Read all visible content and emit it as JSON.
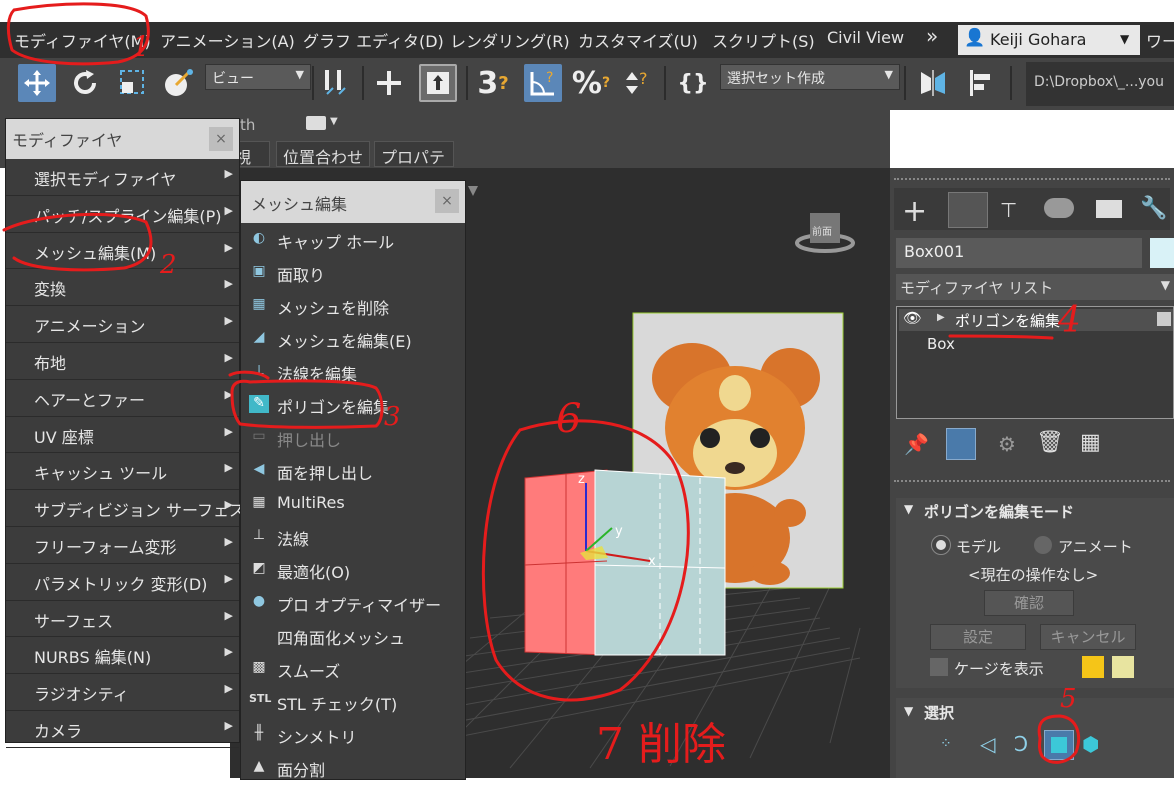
{
  "menubar": {
    "items": [
      "モディファイヤ(M)",
      "アニメーション(A)",
      "グラフ エディタ(D)",
      "レンダリング(R)",
      "カスタマイズ(U)",
      "スクリプト(S)",
      "Civil View"
    ],
    "more": "»",
    "user": "Keiji Gohara",
    "workspace": "ワー"
  },
  "toolbar": {
    "view_dropdown": "ビュー",
    "selection_set": "選択セット作成",
    "path": "D:\\Dropbox\\_...you"
  },
  "row3": {
    "tab_partial": "th",
    "tabs": [
      "視性",
      "位置合わせ",
      "プロパティ"
    ]
  },
  "modifier_menu": {
    "title": "モディファイヤ",
    "close": "×",
    "items": [
      "選択モディファイヤ",
      "パッチ/スプライン編集(P)",
      "メッシュ編集(M)",
      "変換",
      "アニメーション",
      "布地",
      "ヘアーとファー",
      "UV 座標",
      "キャッシュ ツール",
      "サブディビジョン サーフェス",
      "フリーフォーム変形",
      "パラメトリック 変形(D)",
      "サーフェス",
      "NURBS 編集(N)",
      "ラジオシティ",
      "カメラ"
    ]
  },
  "mesh_menu": {
    "title": "メッシュ編集",
    "close": "×",
    "items": [
      "キャップ ホール",
      "面取り",
      "メッシュを削除",
      "メッシュを編集(E)",
      "法線を編集",
      "ポリゴンを編集",
      "押し出し",
      "面を押し出し",
      "MultiRes",
      "法線",
      "最適化(O)",
      "プロ オプティマイザー",
      "四角面化メッシュ",
      "スムーズ",
      "STL チェック(T)",
      "シンメトリ",
      "面分割"
    ]
  },
  "viewcube": {
    "label": "前面"
  },
  "command_panel": {
    "object_name": "Box001",
    "modifier_list": "モディファイヤ リスト",
    "stack": [
      "ポリゴンを編集",
      "Box"
    ],
    "rollout_mode": {
      "title": "ポリゴンを編集モード",
      "radio_model": "モデル",
      "radio_animate": "アニメート",
      "status": "<現在の操作なし>",
      "confirm": "確認",
      "settings": "設定",
      "cancel": "キャンセル",
      "show_cage": "ケージを表示"
    },
    "rollout_select": {
      "title": "選択"
    },
    "colors": {
      "cage1": "#f5c518",
      "cage2": "#e8e4a0",
      "swatch": "#d9f2f7"
    }
  },
  "annotations": {
    "num1": "1",
    "num2": "2",
    "num3": "3",
    "num4": "4",
    "num5": "5",
    "num6": "6",
    "note7": "7 削除"
  },
  "axis": {
    "x": "x",
    "y": "y",
    "z": "z"
  }
}
